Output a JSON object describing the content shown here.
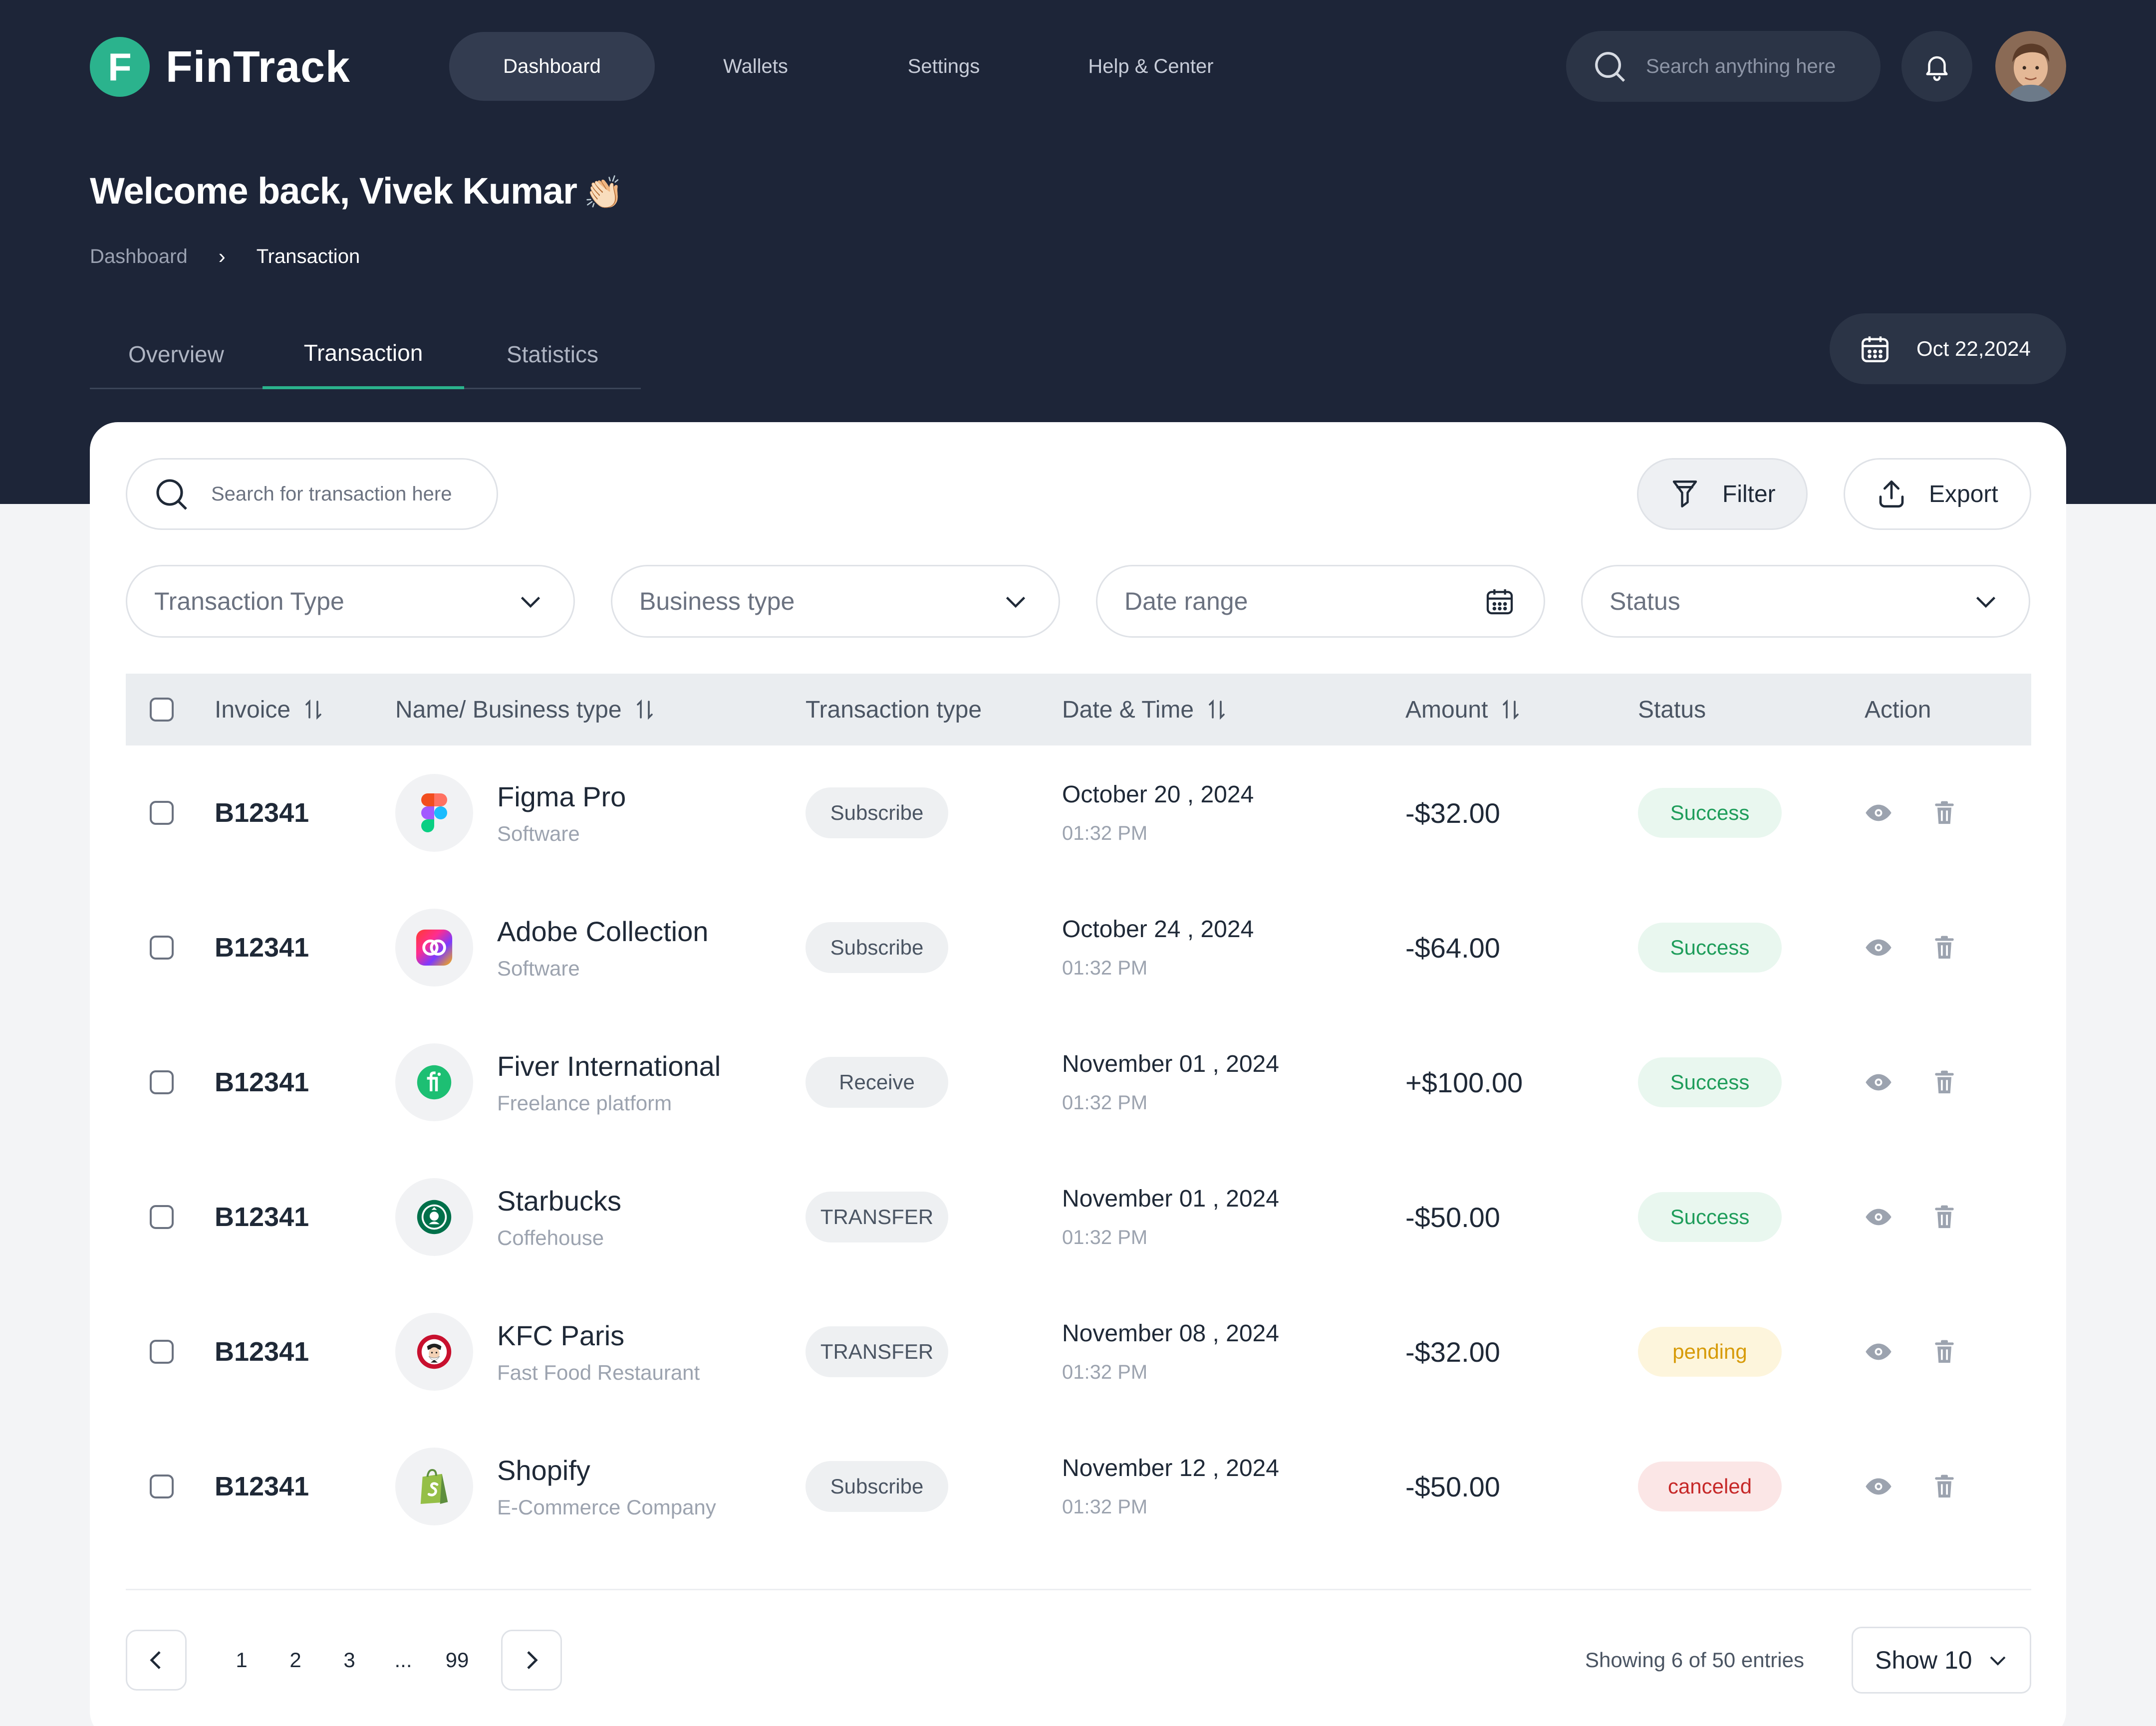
{
  "app": {
    "logo_letter": "F",
    "name": "FinTrack",
    "accent_color": "#2bb38d",
    "header_bg": "#1d2538"
  },
  "nav": {
    "items": [
      "Dashboard",
      "Wallets",
      "Settings",
      "Help & Center"
    ],
    "active": "Dashboard"
  },
  "top_search": {
    "placeholder": "Search anything here"
  },
  "header": {
    "welcome": "Welcome back, Vivek Kumar",
    "wave_emoji": "👏🏻",
    "breadcrumb": [
      "Dashboard",
      "Transaction"
    ]
  },
  "tabs": {
    "items": [
      "Overview",
      "Transaction",
      "Statistics"
    ],
    "active": "Transaction"
  },
  "date_picker": {
    "value": "Oct 22,2024"
  },
  "toolbar": {
    "search_placeholder": "Search for transaction here",
    "filter_label": "Filter",
    "export_label": "Export"
  },
  "filters": {
    "transaction_type": "Transaction Type",
    "business_type": "Business type",
    "date_range": "Date range",
    "status": "Status"
  },
  "table": {
    "headers": {
      "invoice": "Invoice",
      "name": "Name/ Business type",
      "type": "Transaction type",
      "date": "Date & Time",
      "amount": "Amount",
      "status": "Status",
      "action": "Action"
    },
    "rows": [
      {
        "invoice": "B12341",
        "name": "Figma Pro",
        "business": "Software",
        "type": "Subscribe",
        "date": "October 20 , 2024",
        "time": "01:32 PM",
        "amount": "-$32.00",
        "status": "Success",
        "logo": "figma-logo"
      },
      {
        "invoice": "B12341",
        "name": "Adobe Collection",
        "business": "Software",
        "type": "Subscribe",
        "date": "October 24 , 2024",
        "time": "01:32 PM",
        "amount": "-$64.00",
        "status": "Success",
        "logo": "adobe-cc-logo"
      },
      {
        "invoice": "B12341",
        "name": "Fiver International",
        "business": "Freelance platform",
        "type": "Receive",
        "date": "November 01 , 2024",
        "time": "01:32 PM",
        "amount": "+$100.00",
        "status": "Success",
        "logo": "fiverr-logo"
      },
      {
        "invoice": "B12341",
        "name": "Starbucks",
        "business": "Coffehouse",
        "type": "TRANSFER",
        "date": "November 01 , 2024",
        "time": "01:32 PM",
        "amount": "-$50.00",
        "status": "Success",
        "logo": "starbucks-logo"
      },
      {
        "invoice": "B12341",
        "name": "KFC Paris",
        "business": "Fast Food Restaurant",
        "type": "TRANSFER",
        "date": "November 08 , 2024",
        "time": "01:32 PM",
        "amount": "-$32.00",
        "status": "pending",
        "logo": "kfc-logo"
      },
      {
        "invoice": "B12341",
        "name": "Shopify",
        "business": "E-Commerce Company",
        "type": "Subscribe",
        "date": "November 12 , 2024",
        "time": "01:32 PM",
        "amount": "-$50.00",
        "status": "canceled",
        "logo": "shopify-logo"
      }
    ]
  },
  "pagination": {
    "pages": [
      "1",
      "2",
      "3",
      "...",
      "99"
    ],
    "summary": "Showing 6 of 50 entries",
    "page_size": "Show 10"
  },
  "status_colors": {
    "success": "#1f9d5b",
    "pending": "#d79b09",
    "canceled": "#c62828"
  }
}
